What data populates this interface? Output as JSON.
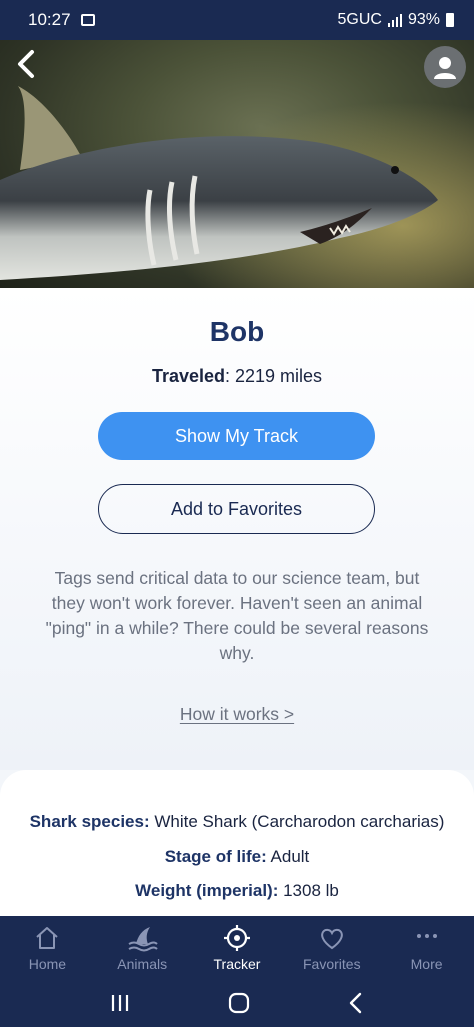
{
  "status_bar": {
    "time": "10:27",
    "network": "5GUC",
    "battery": "93%"
  },
  "profile": {
    "name": "Bob",
    "traveled_label": "Traveled",
    "traveled_value": ": 2219 miles"
  },
  "actions": {
    "show_track": "Show My Track",
    "add_favorites": "Add to Favorites"
  },
  "info": {
    "text": "Tags send critical data to our science team, but they won't work forever. Haven't seen an animal \"ping\" in a while? There could be several reasons why.",
    "link": "How it works >"
  },
  "details": {
    "species_label": "Shark species:",
    "species_value": " White Shark (Carcharodon carcharias)",
    "stage_label": "Stage of life:",
    "stage_value": " Adult",
    "weight_label": "Weight (imperial):",
    "weight_value": " 1308 lb"
  },
  "tabs": [
    {
      "label": "Home",
      "icon": "home-icon",
      "active": false
    },
    {
      "label": "Animals",
      "icon": "shark-fin-icon",
      "active": false
    },
    {
      "label": "Tracker",
      "icon": "tracker-icon",
      "active": true
    },
    {
      "label": "Favorites",
      "icon": "heart-icon",
      "active": false
    },
    {
      "label": "More",
      "icon": "more-icon",
      "active": false
    }
  ],
  "colors": {
    "navy": "#1a2a52",
    "accent": "#3e92f1",
    "title": "#1e3466"
  }
}
